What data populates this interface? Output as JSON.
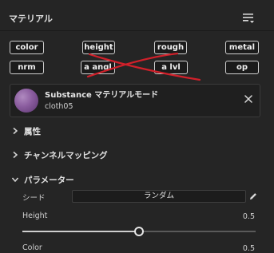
{
  "panel": {
    "title": "マテリアル",
    "menu_icon": "list-filter-icon"
  },
  "channels": {
    "row1": [
      "color",
      "height",
      "rough",
      "metal"
    ],
    "row2": [
      "nrm",
      "a angl",
      "a lvl",
      "op"
    ]
  },
  "material": {
    "title": "Substance マテリアルモード",
    "name": "cloth05",
    "close_icon": "close-icon"
  },
  "sections": {
    "attributes": "属性",
    "channel_mapping": "チャンネルマッピング",
    "parameters": "パラメーター"
  },
  "parameters": {
    "seed_label": "シード",
    "seed_value": "ランダム",
    "height_label": "Height",
    "height_value": "0.5",
    "height_fraction": 0.5,
    "color_label": "Color",
    "color_value": "0.5"
  },
  "colors": {
    "strike": "#d0202a",
    "accent": "#e6e6e6"
  }
}
